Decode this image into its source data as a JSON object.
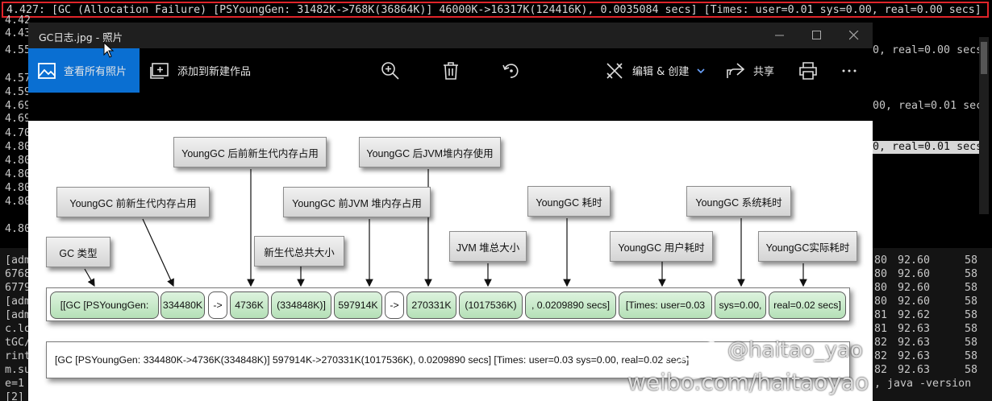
{
  "terminal": {
    "highlighted_line": "4.427: [GC (Allocation Failure) [PSYoungGen: 31482K->768K(36864K)] 46000K->16317K(124416K), 0.0035084 secs] [Times: user=0.01 sys=0.00, real=0.00 secs]",
    "prefixes": [
      "4.42",
      "4.43",
      "4.55",
      "4.57",
      "4.59",
      "4.69",
      "4.69",
      "4.70",
      "4.80",
      "4.80",
      "4.80",
      "4.80",
      "4.80",
      "4.80"
    ],
    "right_lines": [
      "0, real=0.00 secs]",
      "00, real=0.01 secs",
      "0, real=0.01 secs]"
    ],
    "bottom_left": [
      "[adm",
      "6768",
      "6779",
      "[adm",
      "[adm",
      "c.lo",
      "tGC/",
      "rint",
      "m.su",
      "e=1",
      "[2]"
    ],
    "bottom_table": [
      [
        "80",
        "92.60",
        "58"
      ],
      [
        "80",
        "92.60",
        "58"
      ],
      [
        "80",
        "92.60",
        "58"
      ],
      [
        "80",
        "92.60",
        "58"
      ],
      [
        "81",
        "92.62",
        "58"
      ],
      [
        "81",
        "92.63",
        "58"
      ],
      [
        "82",
        "92.63",
        "58"
      ],
      [
        "82",
        "92.63",
        "58"
      ],
      [
        "82",
        "92.63",
        "58"
      ]
    ],
    "version_text": ", java -version"
  },
  "window": {
    "title": "GC日志.jpg - 照片",
    "toolbar": {
      "view_all_label": "查看所有照片",
      "add_to_new_label": "添加到新建作品",
      "edit_create_label": "编辑 & 创建",
      "share_label": "共享"
    }
  },
  "diagram": {
    "callouts": {
      "gc_type": "GC 类型",
      "young_before": "YoungGC 前新生代内存占用",
      "young_after": "YoungGC 后前新生代内存占用",
      "young_total": "新生代总共大小",
      "jvm_before": "YoungGC 前JVM 堆内存占用",
      "jvm_after": "YoungGC 后JVM堆内存使用",
      "jvm_total": "JVM 堆总大小",
      "gc_time": "YoungGC 耗时",
      "user_time": "YoungGC 用户耗时",
      "sys_time": "YoungGC 系统耗时",
      "real_time": "YoungGC实际耗时"
    },
    "segments": [
      "[[GC [PSYoungGen:",
      "334480K",
      "->",
      "4736K",
      "(334848K)]",
      "597914K",
      "->",
      "270331K",
      "(1017536K)",
      ", 0.0209890 secs]",
      "[Times: user=0.03",
      "sys=0.00,",
      "real=0.02 secs]"
    ],
    "full_line": "[GC [PSYoungGen: 334480K->4736K(334848K)] 597914K->270331K(1017536K), 0.0209890 secs] [Times: user=0.03 sys=0.00, real=0.02 secs]"
  },
  "watermark": {
    "handle": "@haitao_yao",
    "url": "weibo.com/haitaoyao"
  }
}
